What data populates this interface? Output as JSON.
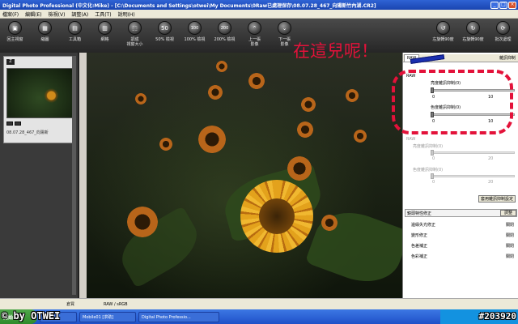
{
  "window": {
    "title": "Digital Photo Professional (中文化:Mike) - [C:\\Documents and Settings\\otwei\\My Documents\\0Raw已處理保存\\08.07.28_467_向陽新竹內湖.CR2]",
    "buttons": [
      "_",
      "□",
      "×"
    ]
  },
  "menubar": [
    "檔案(F)",
    "編輯(E)",
    "檢視(V)",
    "調整(A)",
    "工具(T)",
    "說明(H)"
  ],
  "toolbar": [
    {
      "label": "回主視窗",
      "icon": "home-icon",
      "glyph": "▣"
    },
    {
      "label": "縮圖",
      "icon": "thumbnails-icon",
      "glyph": "▦"
    },
    {
      "label": "工具箱",
      "icon": "toolbox-icon",
      "glyph": "▤"
    },
    {
      "label": "網格",
      "icon": "grid-icon",
      "glyph": "▥"
    },
    {
      "label": "調成\n視窗大小",
      "icon": "fit-window-icon",
      "glyph": "⬚"
    },
    {
      "label": "50% 檢視",
      "icon": "zoom-50-icon",
      "glyph": "50"
    },
    {
      "label": "100% 檢視",
      "icon": "zoom-100-icon",
      "glyph": "100"
    },
    {
      "label": "200% 檢視",
      "icon": "zoom-200-icon",
      "glyph": "200"
    },
    {
      "label": "上一張\n影像",
      "icon": "previous-image-icon",
      "glyph": "⌃"
    },
    {
      "label": "下一張\n影像",
      "icon": "next-image-icon",
      "glyph": "⌄"
    }
  ],
  "toolbar_right": [
    {
      "label": "左旋轉90度",
      "icon": "rotate-left-icon",
      "glyph": "↺"
    },
    {
      "label": "右旋轉90度",
      "icon": "rotate-right-icon",
      "glyph": "↻"
    },
    {
      "label": "批次處理",
      "icon": "batch-process-icon",
      "glyph": "⟳"
    }
  ],
  "thumbnail": {
    "badge": "Z",
    "caption": "08.07.28_467_向陽新"
  },
  "annotation": {
    "text": "在這兒呢！"
  },
  "right_panel": {
    "tab_raw": "RAW",
    "tab_other": "雜訊抑制",
    "section_raw": "RAW",
    "luminance_label": "亮度雜訊抑制(0)",
    "luminance_min": "0",
    "luminance_max": "10",
    "color_label": "色度雜訊抑制(0)",
    "color_min": "0",
    "color_max": "10",
    "section_raw2": "RAW",
    "luminance2_label": "亮度雜訊抑制(0)",
    "luminance2_min": "0",
    "luminance2_max": "20",
    "color2_label": "色度雜訊抑制(0)",
    "color2_min": "0",
    "color2_max": "20",
    "reset_button": "套用雜訊抑制設定",
    "lens_header": "鏡頭特性修正",
    "lens_button": "調整",
    "lens_rows": [
      {
        "label": "邊緣失光修正",
        "value": "關閉"
      },
      {
        "label": "變形修正",
        "value": "關閉"
      },
      {
        "label": "色差補正",
        "value": "關閉"
      },
      {
        "label": "色彩補正",
        "value": "關閉"
      }
    ]
  },
  "status": {
    "left": "倉買",
    "format": "RAW / sRGB"
  },
  "taskbar": {
    "start": "開始",
    "tasks": [
      "可分享...",
      "Mobile01 [求助]",
      "Digital Photo Professio..."
    ]
  },
  "watermarks": {
    "left": "© by OTWEI",
    "right": "#203920"
  }
}
